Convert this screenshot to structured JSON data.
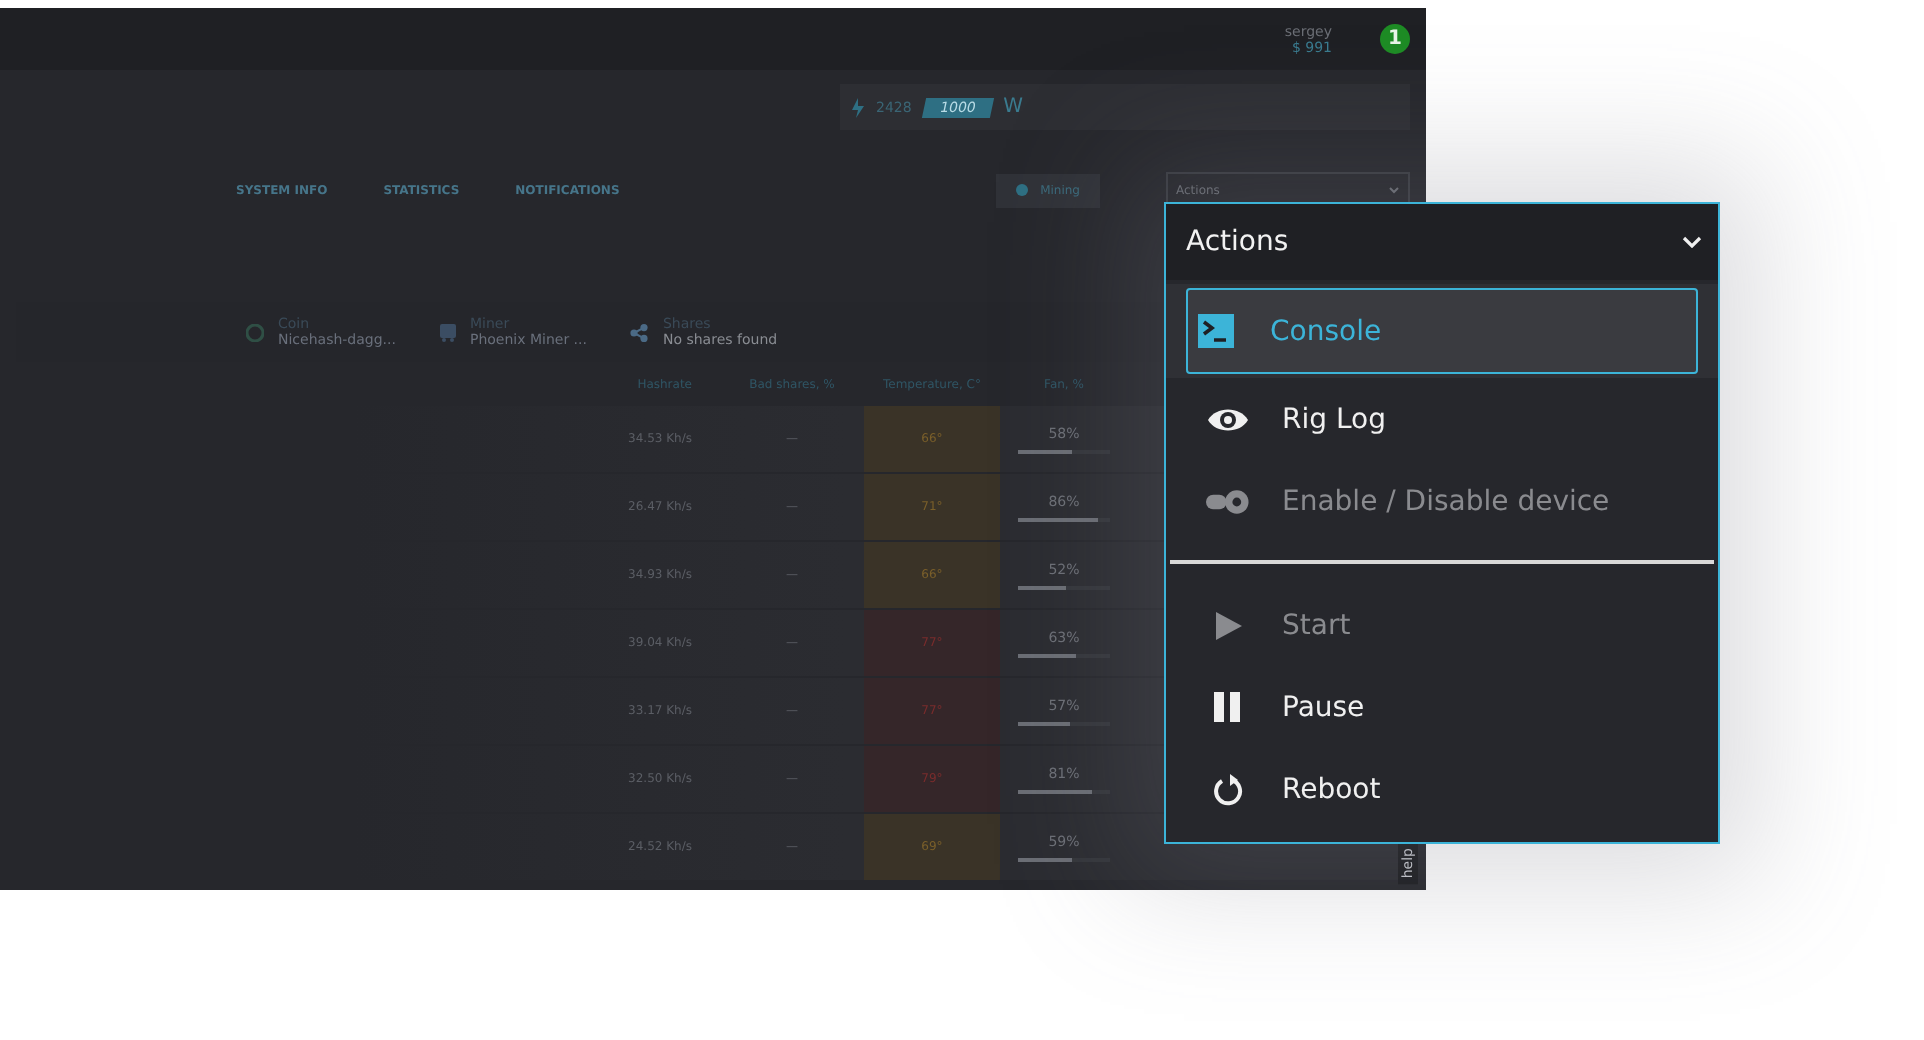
{
  "user": {
    "name": "sergey",
    "balance": "$ 991",
    "notifications": "1"
  },
  "power": {
    "current": "2428",
    "limit": "1000",
    "unit": "W"
  },
  "tabs": [
    {
      "label": "SYSTEM INFO",
      "selected": false
    },
    {
      "label": "STATISTICS",
      "selected": false
    },
    {
      "label": "NOTIFICATIONS",
      "selected": false
    }
  ],
  "mining_button": "Mining",
  "actions_select": "Actions",
  "info": [
    {
      "kind": "coin",
      "label": "Coin",
      "value": "Nicehash-dagg..."
    },
    {
      "kind": "miner",
      "label": "Miner",
      "value": "Phoenix Miner ..."
    },
    {
      "kind": "shares",
      "label": "Shares",
      "value": "No shares found"
    }
  ],
  "table": {
    "columns": [
      "Hashrate",
      "Bad shares, %",
      "Temperature, C°",
      "Fan, %"
    ],
    "rows": [
      {
        "hashrate": "34.53 Kh/s",
        "bad_shares": "—",
        "temperature": "66°",
        "kind": "warm",
        "fan": "58%",
        "level": 0.58
      },
      {
        "hashrate": "26.47 Kh/s",
        "bad_shares": "—",
        "temperature": "71°",
        "kind": "warm",
        "fan": "86%",
        "level": 0.86
      },
      {
        "hashrate": "34.93 Kh/s",
        "bad_shares": "—",
        "temperature": "66°",
        "kind": "warm",
        "fan": "52%",
        "level": 0.52
      },
      {
        "hashrate": "39.04 Kh/s",
        "bad_shares": "—",
        "temperature": "77°",
        "kind": "hot",
        "fan": "63%",
        "level": 0.63
      },
      {
        "hashrate": "33.17 Kh/s",
        "bad_shares": "—",
        "temperature": "77°",
        "kind": "hot",
        "fan": "57%",
        "level": 0.57
      },
      {
        "hashrate": "32.50 Kh/s",
        "bad_shares": "—",
        "temperature": "79°",
        "kind": "hot",
        "fan": "81%",
        "level": 0.81
      },
      {
        "hashrate": "24.52 Kh/s",
        "bad_shares": "—",
        "temperature": "69°",
        "kind": "warm",
        "fan": "59%",
        "level": 0.59
      }
    ]
  },
  "help_tab": "help",
  "dropdown": {
    "title": "Actions",
    "items": [
      {
        "kind": "console",
        "label": "Console",
        "selected": true,
        "disabled": false
      },
      {
        "kind": "log",
        "label": "Rig Log",
        "selected": false,
        "disabled": false
      },
      {
        "kind": "toggle",
        "label": "Enable / Disable device",
        "selected": false,
        "disabled": true
      },
      {
        "kind": "divider"
      },
      {
        "kind": "start",
        "label": "Start",
        "selected": false,
        "disabled": true
      },
      {
        "kind": "pause",
        "label": "Pause",
        "selected": false,
        "disabled": false
      },
      {
        "kind": "reboot",
        "label": "Reboot",
        "selected": false,
        "disabled": false
      }
    ]
  }
}
